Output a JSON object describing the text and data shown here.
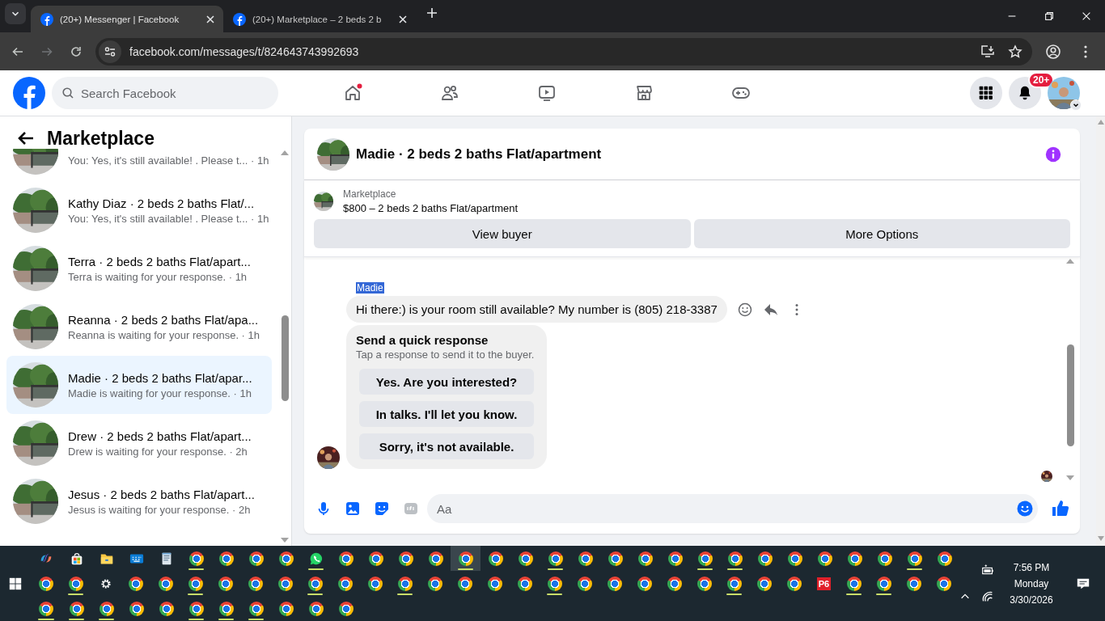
{
  "browser": {
    "tabs": [
      {
        "title": "(20+) Messenger | Facebook",
        "selected": true
      },
      {
        "title": "(20+) Marketplace – 2 beds 2 b",
        "selected": false
      }
    ],
    "url": "facebook.com/messages/t/824643743992693"
  },
  "header": {
    "search": {
      "placeholder": "Search Facebook"
    },
    "nav": [
      {
        "kind": "home",
        "dot": true
      },
      {
        "kind": "friends",
        "dot": false
      },
      {
        "kind": "watch",
        "dot": false
      },
      {
        "kind": "marketplace",
        "dot": false
      },
      {
        "kind": "gaming",
        "dot": false
      }
    ],
    "notifications_badge": "20+"
  },
  "sidebar": {
    "title": "Marketplace",
    "conversations": [
      {
        "snippet": "You: Yes, it's still available! . Please t... · 1h",
        "selected": false
      },
      {
        "title": "Kathy Diaz · 2 beds 2 baths Flat/...",
        "snippet": "You: Yes, it's still available! . Please t... · 1h",
        "selected": false
      },
      {
        "title": "Terra · 2 beds 2 baths Flat/apart...",
        "snippet": "Terra is waiting for your response. · 1h",
        "selected": false
      },
      {
        "title": "Reanna · 2 beds 2 baths Flat/apa...",
        "snippet": "Reanna is waiting for your response. · 1h",
        "selected": false
      },
      {
        "title": "Madie · 2 beds 2 baths Flat/apar...",
        "snippet": "Madie is waiting for your response. · 1h",
        "selected": true
      },
      {
        "title": "Drew · 2 beds 2 baths Flat/apart...",
        "snippet": "Drew is waiting for your response. · 2h",
        "selected": false
      },
      {
        "title": "Jesus · 2 beds 2 baths Flat/apart...",
        "snippet": "Jesus is waiting for your response. · 2h",
        "selected": false
      }
    ]
  },
  "chat": {
    "title": "Madie · 2 beds 2 baths Flat/apartment",
    "listing": {
      "source": "Marketplace",
      "summary": "$800 – 2 beds 2 baths Flat/apartment"
    },
    "actions": [
      "View buyer",
      "More Options"
    ],
    "sender": {
      "name": "Madie",
      "highlighted": true
    },
    "message": "Hi there:) is your room still available? My number is (805) 218-3387",
    "quick_response": {
      "title": "Send a quick response",
      "hint": "Tap a response to send it to the buyer.",
      "options": [
        "Yes. Are you interested?",
        "In talks. I'll let you know.",
        "Sorry, it's not available."
      ]
    },
    "composer": {
      "placeholder": "Aa"
    }
  },
  "taskbar": {
    "rows": [
      [
        {
          "kind": "copilot",
          "running": false,
          "active": false
        },
        {
          "kind": "store",
          "running": false,
          "active": false
        },
        {
          "kind": "folder",
          "running": false,
          "active": false
        },
        {
          "kind": "keyboard",
          "running": false,
          "active": false
        },
        {
          "kind": "notepad",
          "running": false,
          "active": false
        },
        {
          "kind": "chrome",
          "running": true,
          "active": false
        },
        {
          "kind": "chrome",
          "running": false,
          "active": false
        },
        {
          "kind": "chrome",
          "running": false,
          "active": false
        },
        {
          "kind": "chrome",
          "running": false,
          "active": false
        },
        {
          "kind": "whatsapp",
          "running": true,
          "active": false
        },
        {
          "kind": "chrome",
          "running": false,
          "active": false
        },
        {
          "kind": "chrome",
          "running": false,
          "active": false
        },
        {
          "kind": "chrome",
          "running": false,
          "active": false
        },
        {
          "kind": "chrome",
          "running": false,
          "active": false
        },
        {
          "kind": "chrome",
          "running": true,
          "active": true
        },
        {
          "kind": "chrome",
          "running": false,
          "active": false
        },
        {
          "kind": "chrome",
          "running": false,
          "active": false
        },
        {
          "kind": "chrome",
          "running": true,
          "active": false
        },
        {
          "kind": "chrome",
          "running": false,
          "active": false
        },
        {
          "kind": "chrome",
          "running": false,
          "active": false
        },
        {
          "kind": "chrome",
          "running": false,
          "active": false
        },
        {
          "kind": "chrome",
          "running": false,
          "active": false
        },
        {
          "kind": "chrome",
          "running": true,
          "active": false
        },
        {
          "kind": "chrome",
          "running": true,
          "active": false
        },
        {
          "kind": "chrome",
          "running": false,
          "active": false
        },
        {
          "kind": "chrome",
          "running": false,
          "active": false
        },
        {
          "kind": "chrome",
          "running": false,
          "active": false
        },
        {
          "kind": "chrome",
          "running": false,
          "active": false
        },
        {
          "kind": "chrome",
          "running": false,
          "active": false
        },
        {
          "kind": "chrome",
          "running": true,
          "active": false
        },
        {
          "kind": "chrome",
          "running": false,
          "active": false
        }
      ],
      [
        {
          "kind": "start",
          "running": false,
          "active": false
        },
        {
          "kind": "chrome",
          "running": false,
          "active": false
        },
        {
          "kind": "chrome",
          "running": true,
          "active": false
        },
        {
          "kind": "gear",
          "running": false,
          "active": false
        },
        {
          "kind": "chrome",
          "running": false,
          "active": false
        },
        {
          "kind": "chrome",
          "running": false,
          "active": false
        },
        {
          "kind": "chrome",
          "running": true,
          "active": false
        },
        {
          "kind": "chrome",
          "running": false,
          "active": false
        },
        {
          "kind": "chrome",
          "running": false,
          "active": false
        },
        {
          "kind": "chrome",
          "running": false,
          "active": false
        },
        {
          "kind": "chrome",
          "running": true,
          "active": false
        },
        {
          "kind": "chrome",
          "running": false,
          "active": false
        },
        {
          "kind": "chrome",
          "running": false,
          "active": false
        },
        {
          "kind": "chrome",
          "running": true,
          "active": false
        },
        {
          "kind": "chrome",
          "running": false,
          "active": false
        },
        {
          "kind": "chrome",
          "running": false,
          "active": false
        },
        {
          "kind": "chrome",
          "running": false,
          "active": false
        },
        {
          "kind": "chrome",
          "running": false,
          "active": false
        },
        {
          "kind": "chrome",
          "running": true,
          "active": false
        },
        {
          "kind": "chrome",
          "running": false,
          "active": false
        },
        {
          "kind": "chrome",
          "running": false,
          "active": false
        },
        {
          "kind": "chrome",
          "running": false,
          "active": false
        },
        {
          "kind": "chrome",
          "running": false,
          "active": false
        },
        {
          "kind": "chrome",
          "running": false,
          "active": false
        },
        {
          "kind": "chrome",
          "running": true,
          "active": false
        },
        {
          "kind": "chrome",
          "running": false,
          "active": false
        },
        {
          "kind": "chrome",
          "running": false,
          "active": false
        },
        {
          "kind": "label",
          "label": "P6",
          "running": false,
          "active": false
        },
        {
          "kind": "chrome",
          "running": true,
          "active": false
        },
        {
          "kind": "chrome",
          "running": true,
          "active": false
        },
        {
          "kind": "chrome",
          "running": false,
          "active": false
        },
        {
          "kind": "chrome",
          "running": false,
          "active": false
        }
      ],
      [
        {
          "kind": "chrome",
          "running": true,
          "active": false
        },
        {
          "kind": "chrome",
          "running": true,
          "active": false
        },
        {
          "kind": "chrome",
          "running": true,
          "active": false
        },
        {
          "kind": "chrome",
          "running": false,
          "active": false
        },
        {
          "kind": "chrome",
          "running": false,
          "active": false
        },
        {
          "kind": "chrome",
          "running": true,
          "active": false
        },
        {
          "kind": "chrome",
          "running": true,
          "active": false
        },
        {
          "kind": "chrome",
          "running": true,
          "active": false
        },
        {
          "kind": "chrome",
          "running": false,
          "active": false
        },
        {
          "kind": "chrome",
          "running": false,
          "active": false
        },
        {
          "kind": "chrome",
          "running": false,
          "active": false
        }
      ]
    ],
    "tray": {
      "time": "7:56 PM",
      "day": "Monday",
      "date": "3/30/2026"
    }
  }
}
